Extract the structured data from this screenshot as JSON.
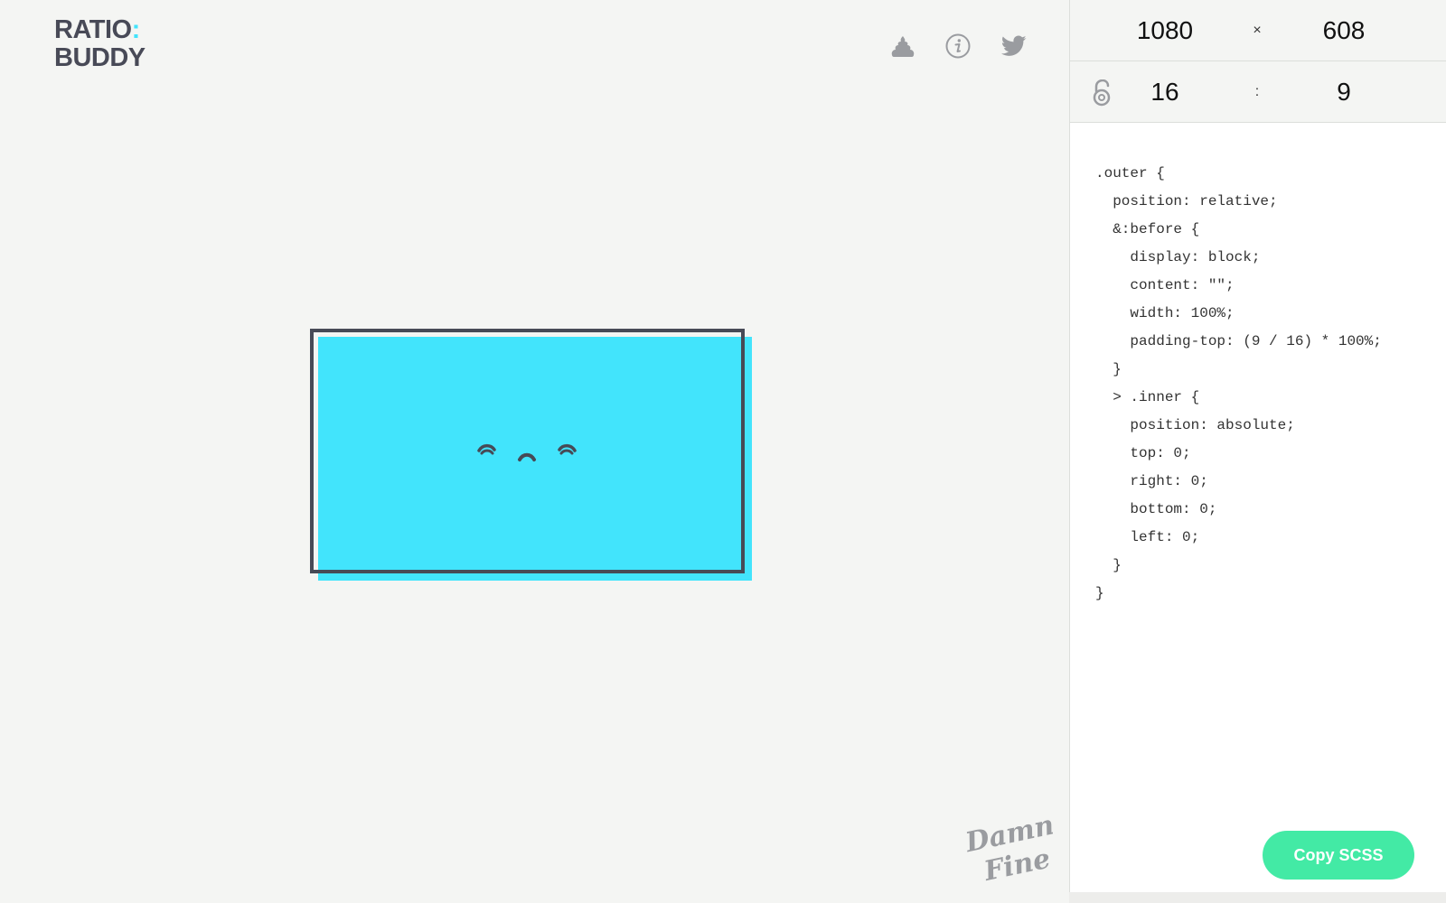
{
  "logo": {
    "line1": "RATIO",
    "colon": ":",
    "line2": "BUDDY"
  },
  "header_icons": [
    "poop-icon",
    "info-icon",
    "twitter-icon"
  ],
  "colors": {
    "accent": "#42e4fc",
    "dark": "#474a56",
    "button": "#43eaa5",
    "background": "#f4f5f3"
  },
  "dimensions": {
    "width": "1080",
    "separator": "×",
    "height": "608"
  },
  "ratio": {
    "lock_icon": "lock-open-icon",
    "width": "16",
    "separator": ":",
    "height": "9"
  },
  "code": {
    "lines": [
      ".outer {",
      "  position: relative;",
      "  &:before {",
      "    display: block;",
      "    content: \"\";",
      "    width: 100%;",
      "    padding-top: (9 / 16) * 100%;",
      "  }",
      "  > .inner {",
      "    position: absolute;",
      "    top: 0;",
      "    right: 0;",
      "    bottom: 0;",
      "    left: 0;",
      "  }",
      "}"
    ]
  },
  "copy_button": {
    "label": "Copy SCSS"
  },
  "signature": {
    "line1": "Damn",
    "line2": "Fine"
  }
}
